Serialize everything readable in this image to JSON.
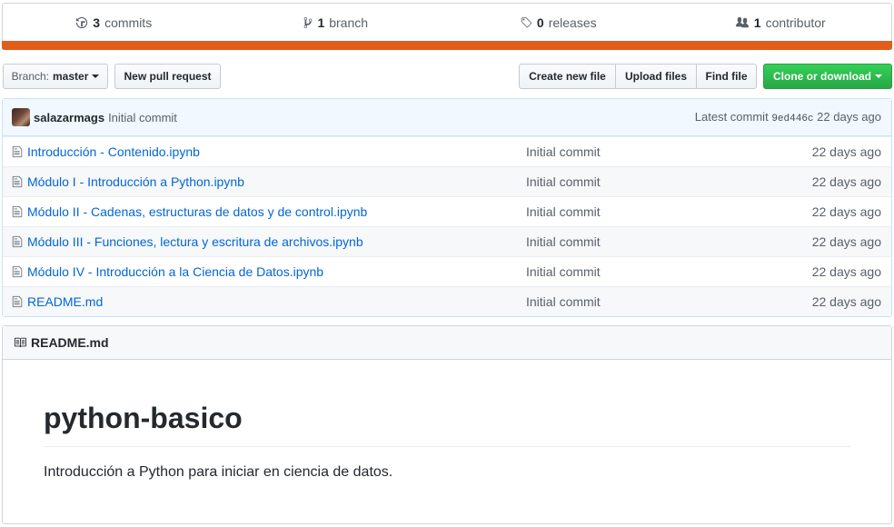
{
  "summary": {
    "commits": {
      "count": "3",
      "label": "commits",
      "icon": "history-icon"
    },
    "branches": {
      "count": "1",
      "label": "branch",
      "icon": "git-branch-icon"
    },
    "releases": {
      "count": "0",
      "label": "releases",
      "icon": "tag-icon"
    },
    "contributors": {
      "count": "1",
      "label": "contributor",
      "icon": "people-icon"
    },
    "language_color": "#e05d1a"
  },
  "toolbar": {
    "branch_prefix": "Branch:",
    "branch_name": "master",
    "new_pull_request": "New pull request",
    "create_new_file": "Create new file",
    "upload_files": "Upload files",
    "find_file": "Find file",
    "clone_or_download": "Clone or download"
  },
  "latest_commit": {
    "author": "salazarmags",
    "message": "Initial commit",
    "prefix": "Latest commit",
    "sha": "9ed446c",
    "age": "22 days ago"
  },
  "files": [
    {
      "name": "Introducción - Contenido.ipynb",
      "message": "Initial commit",
      "age": "22 days ago"
    },
    {
      "name": "Módulo I - Introducción a Python.ipynb",
      "message": "Initial commit",
      "age": "22 days ago"
    },
    {
      "name": "Módulo II - Cadenas, estructuras de datos y de control.ipynb",
      "message": "Initial commit",
      "age": "22 days ago"
    },
    {
      "name": "Módulo III - Funciones, lectura y escritura de archivos.ipynb",
      "message": "Initial commit",
      "age": "22 days ago"
    },
    {
      "name": "Módulo IV - Introducción a la Ciencia de Datos.ipynb",
      "message": "Initial commit",
      "age": "22 days ago"
    },
    {
      "name": "README.md",
      "message": "Initial commit",
      "age": "22 days ago"
    }
  ],
  "readme": {
    "filename": "README.md",
    "title": "python-basico",
    "description": "Introducción a Python para iniciar en ciencia de datos."
  },
  "colors": {
    "link": "#0366d6",
    "primary_button": "#28a745",
    "commit_bg": "#f1f8ff"
  }
}
